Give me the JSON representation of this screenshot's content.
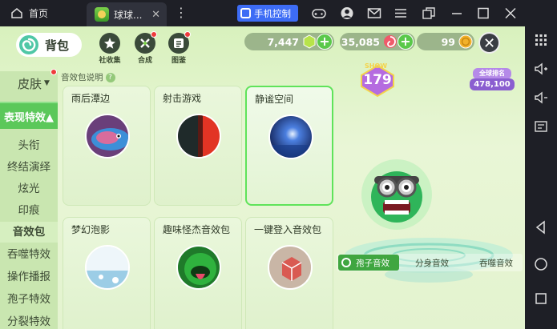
{
  "titlebar": {
    "home_label": "首页",
    "tab_label": "球球...",
    "phone_control_label": "手机控制"
  },
  "header": {
    "bag_label": "背包",
    "icons": [
      {
        "name": "collection",
        "label": "社收集"
      },
      {
        "name": "synthesis",
        "label": "合成"
      },
      {
        "name": "illustrated",
        "label": "图鉴"
      }
    ],
    "currencies": [
      {
        "name": "gems",
        "value": "7,447",
        "color": "#b7e34a"
      },
      {
        "name": "candy",
        "value": "35,085",
        "color": "#f05a6a"
      },
      {
        "name": "coins",
        "value": "99",
        "color": "#f2b12a"
      }
    ]
  },
  "nav": {
    "skin_label": "皮肤",
    "active_label": "表现特效▲",
    "items": [
      {
        "label": "头衔"
      },
      {
        "label": "终结演绎"
      },
      {
        "label": "炫光"
      },
      {
        "label": "印痕"
      },
      {
        "label": "音效包",
        "selected": true
      },
      {
        "label": "吞噬特效"
      },
      {
        "label": "操作播报"
      },
      {
        "label": "孢子特效"
      },
      {
        "label": "分裂特效"
      }
    ]
  },
  "help_label": "音效包说明",
  "cards": [
    {
      "title": "雨后潭边",
      "thumb": "fish"
    },
    {
      "title": "射击游戏",
      "thumb": "redblack"
    },
    {
      "title": "静谧空间",
      "thumb": "night",
      "selected": true
    },
    {
      "title": "梦幻泡影",
      "thumb": "bubble"
    },
    {
      "title": "趣味怪杰音效包",
      "thumb": "monster"
    },
    {
      "title": "一键登入音效包",
      "thumb": "cube"
    }
  ],
  "preview": {
    "show_label": "SHOW",
    "show_value": "179",
    "world_label": "全球排名",
    "world_value": "478,100",
    "tabs": [
      "孢子音效",
      "分身音效",
      "吞噬音效"
    ]
  }
}
